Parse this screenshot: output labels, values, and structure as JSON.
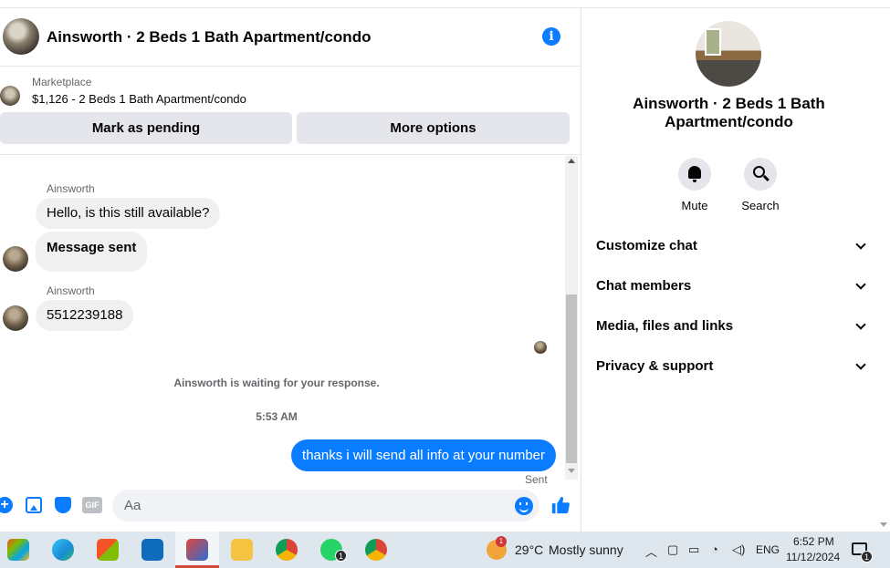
{
  "header": {
    "title": "Ainsworth · 2 Beds 1 Bath Apartment/condo",
    "info_icon": "info-icon"
  },
  "listing": {
    "source": "Marketplace",
    "price_title": "$1,126 - 2 Beds 1 Bath Apartment/condo",
    "mark_pending_label": "Mark as pending",
    "more_options_label": "More options"
  },
  "messages": {
    "group1_sender": "Ainsworth",
    "msg1": "Hello, is this still available?",
    "msg2": "Message sent",
    "group2_sender": "Ainsworth",
    "msg3": "5512239188",
    "waiting_text": "Ainsworth is waiting for your response.",
    "timestamp": "5:53 AM",
    "outgoing": "thanks i will send all info at your number",
    "status": "Sent"
  },
  "composer": {
    "placeholder": "Aa",
    "gif_label": "GIF"
  },
  "panel": {
    "title": "Ainsworth · 2 Beds 1 Bath Apartment/condo",
    "mute_label": "Mute",
    "search_label": "Search",
    "sections": [
      "Customize chat",
      "Chat members",
      "Media, files and links",
      "Privacy & support"
    ]
  },
  "taskbar": {
    "weather_temp": "29°C",
    "weather_desc": "Mostly sunny",
    "weather_badge": "1",
    "language": "ENG",
    "time": "6:52 PM",
    "date": "11/12/2024",
    "whatsapp_badge": "1",
    "notification_badge": "1"
  },
  "colors": {
    "messenger_blue": "#0a7cff",
    "bubble_gray": "#f0f0f0",
    "taskbar_bg": "#dfe7ee"
  }
}
